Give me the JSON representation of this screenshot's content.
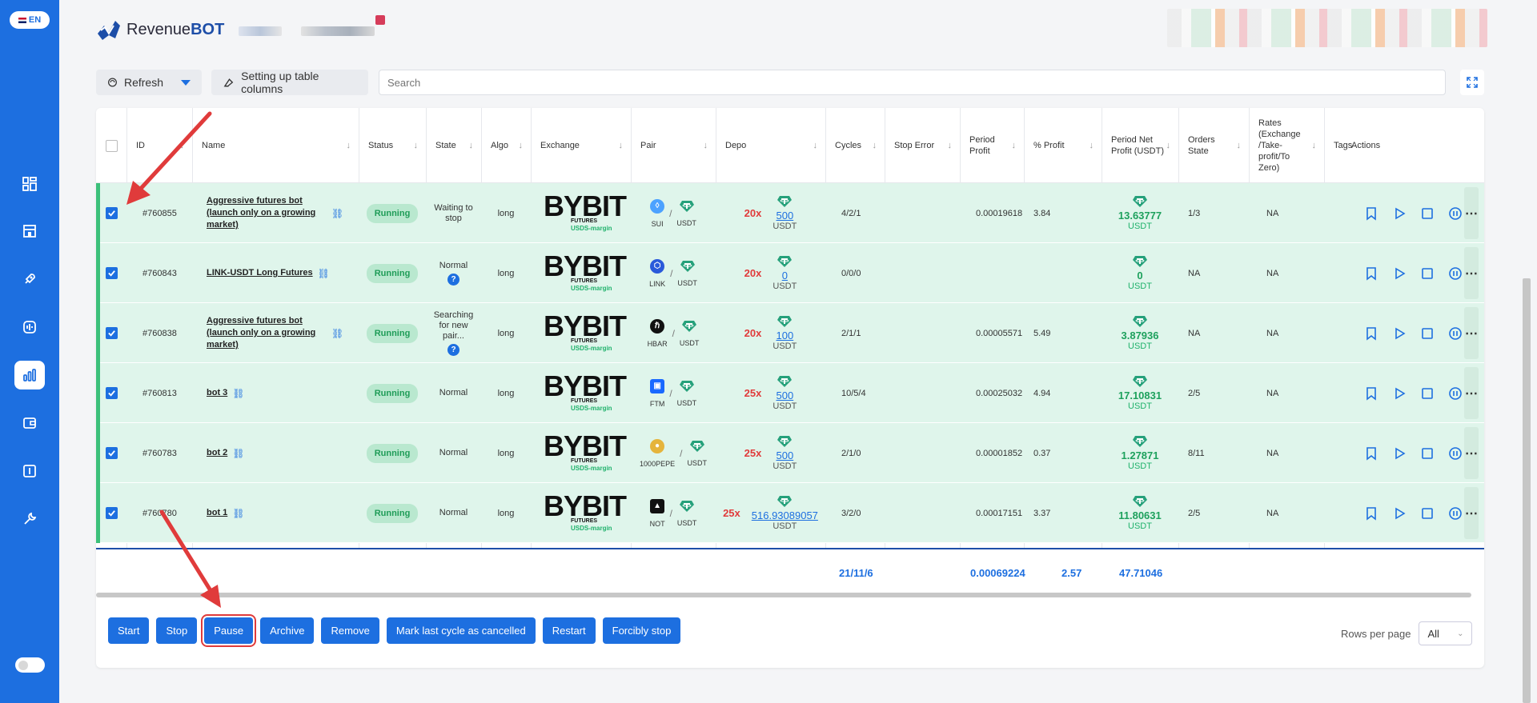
{
  "sidebar": {
    "lang": "EN",
    "items": [
      {
        "icon": "dashboard-icon"
      },
      {
        "icon": "store-icon"
      },
      {
        "icon": "rocket-icon"
      },
      {
        "icon": "chart-box-icon"
      },
      {
        "icon": "bar-chart-icon",
        "active": true
      },
      {
        "icon": "wallet-icon"
      },
      {
        "icon": "book-icon"
      },
      {
        "icon": "wrench-icon"
      }
    ]
  },
  "header": {
    "logo_prefix": "Revenue",
    "logo_suffix": "BOT"
  },
  "toolbar": {
    "refresh_label": "Refresh",
    "columns_label": "Setting up table columns",
    "search_placeholder": "Search"
  },
  "table": {
    "columns": [
      "ID",
      "Name",
      "Status",
      "State",
      "Algo",
      "Exchange",
      "Pair",
      "Depo",
      "Cycles",
      "Stop Error",
      "Period Profit",
      "% Profit",
      "Period Net Profit (USDT)",
      "Orders State",
      "Rates (Exchange /Take-profit/To Zero)",
      "Tags",
      "Actions"
    ],
    "rows": [
      {
        "id": "#760855",
        "name": "Aggressive futures bot (launch only on a growing market)",
        "status": "Running",
        "state": "Waiting to stop",
        "state_help": false,
        "algo": "long",
        "exchange_brand": "BYBIT",
        "exchange_sub1": "FUTURES",
        "exchange_sub2": "USDS-margin",
        "base": "SUI",
        "quote": "USDT",
        "leverage": "20x",
        "depo": "500",
        "depo_unit": "USDT",
        "cycles": "4/2/1",
        "stop_error": "",
        "period_profit": "0.00019618",
        "pct_profit": "3.84",
        "net_profit": "13.63777",
        "net_unit": "USDT",
        "orders_state": "1/3",
        "rates": "NA"
      },
      {
        "id": "#760843",
        "name": "LINK-USDT Long Futures",
        "status": "Running",
        "state": "Normal",
        "state_help": true,
        "algo": "long",
        "exchange_brand": "BYBIT",
        "exchange_sub1": "FUTURES",
        "exchange_sub2": "USDS-margin",
        "base": "LINK",
        "quote": "USDT",
        "leverage": "20x",
        "depo": "0",
        "depo_unit": "USDT",
        "cycles": "0/0/0",
        "stop_error": "",
        "period_profit": "",
        "pct_profit": "",
        "net_profit": "0",
        "net_unit": "USDT",
        "orders_state": "NA",
        "rates": "NA"
      },
      {
        "id": "#760838",
        "name": "Aggressive futures bot (launch only on a growing market)",
        "status": "Running",
        "state": "Searching for new pair...",
        "state_help": true,
        "algo": "long",
        "exchange_brand": "BYBIT",
        "exchange_sub1": "FUTURES",
        "exchange_sub2": "USDS-margin",
        "base": "HBAR",
        "quote": "USDT",
        "leverage": "20x",
        "depo": "100",
        "depo_unit": "USDT",
        "cycles": "2/1/1",
        "stop_error": "",
        "period_profit": "0.00005571",
        "pct_profit": "5.49",
        "net_profit": "3.87936",
        "net_unit": "USDT",
        "orders_state": "NA",
        "rates": "NA"
      },
      {
        "id": "#760813",
        "name": "bot 3",
        "status": "Running",
        "state": "Normal",
        "state_help": false,
        "algo": "long",
        "exchange_brand": "BYBIT",
        "exchange_sub1": "FUTURES",
        "exchange_sub2": "USDS-margin",
        "base": "FTM",
        "quote": "USDT",
        "leverage": "25x",
        "depo": "500",
        "depo_unit": "USDT",
        "cycles": "10/5/4",
        "stop_error": "",
        "period_profit": "0.00025032",
        "pct_profit": "4.94",
        "net_profit": "17.10831",
        "net_unit": "USDT",
        "orders_state": "2/5",
        "rates": "NA"
      },
      {
        "id": "#760783",
        "name": "bot 2",
        "status": "Running",
        "state": "Normal",
        "state_help": false,
        "algo": "long",
        "exchange_brand": "BYBIT",
        "exchange_sub1": "FUTURES",
        "exchange_sub2": "USDS-margin",
        "base": "1000PEPE",
        "quote": "USDT",
        "leverage": "25x",
        "depo": "500",
        "depo_unit": "USDT",
        "cycles": "2/1/0",
        "stop_error": "",
        "period_profit": "0.00001852",
        "pct_profit": "0.37",
        "net_profit": "1.27871",
        "net_unit": "USDT",
        "orders_state": "8/11",
        "rates": "NA"
      },
      {
        "id": "#760780",
        "name": "bot 1",
        "status": "Running",
        "state": "Normal",
        "state_help": false,
        "algo": "long",
        "exchange_brand": "BYBIT",
        "exchange_sub1": "FUTURES",
        "exchange_sub2": "USDS-margin",
        "base": "NOT",
        "quote": "USDT",
        "leverage": "25x",
        "depo": "516.93089057",
        "depo_unit": "USDT",
        "cycles": "3/2/0",
        "stop_error": "",
        "period_profit": "0.00017151",
        "pct_profit": "3.37",
        "net_profit": "11.80631",
        "net_unit": "USDT",
        "orders_state": "2/5",
        "rates": "NA"
      }
    ],
    "totals": {
      "cycles": "21/11/6",
      "period_profit": "0.00069224",
      "pct_profit": "2.57",
      "net_profit": "47.71046"
    }
  },
  "actions": [
    "Start",
    "Stop",
    "Pause",
    "Archive",
    "Remove",
    "Mark last cycle as cancelled",
    "Restart",
    "Forcibly stop"
  ],
  "pagination": {
    "label": "Rows per page",
    "value": "All"
  },
  "colors": {
    "accent": "#1d6fe0",
    "running_bg": "#dff5eb",
    "annotation_red": "#e03b3b"
  }
}
